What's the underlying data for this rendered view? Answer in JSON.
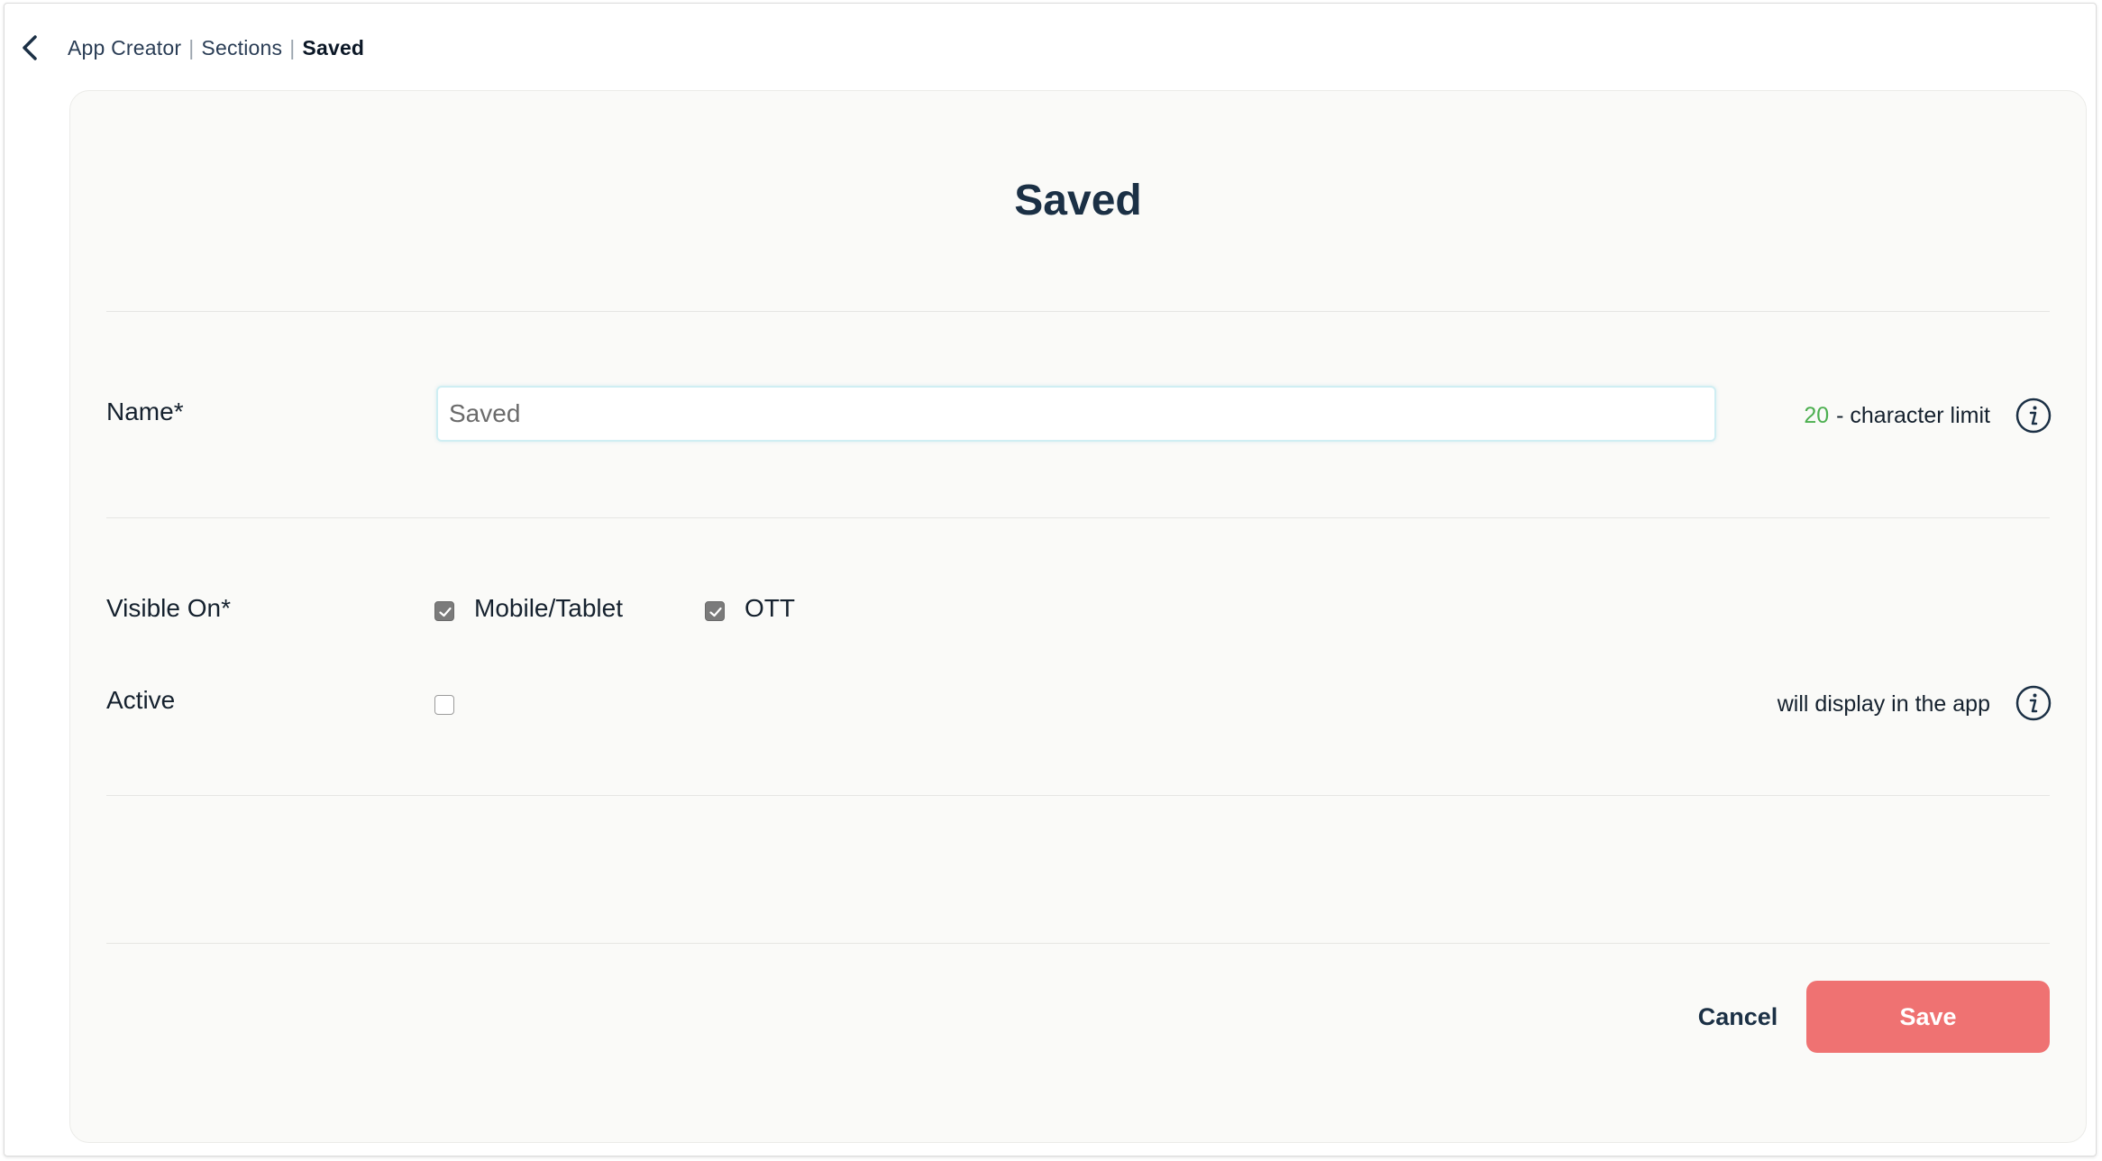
{
  "breadcrumb": {
    "items": [
      "App Creator",
      "Sections"
    ],
    "separator": "|",
    "current": "Saved"
  },
  "page": {
    "title": "Saved"
  },
  "form": {
    "name": {
      "label": "Name*",
      "value": "Saved",
      "char_limit_count": "20",
      "char_limit_text": "- character limit"
    },
    "visible_on": {
      "label": "Visible On*",
      "options": [
        {
          "label": "Mobile/Tablet",
          "checked": true
        },
        {
          "label": "OTT",
          "checked": true
        }
      ]
    },
    "active": {
      "label": "Active",
      "checked": false,
      "hint": "will display in the app"
    }
  },
  "actions": {
    "cancel_label": "Cancel",
    "save_label": "Save"
  },
  "colors": {
    "accent_save": "#ef7272",
    "count_green": "#4caf50",
    "text_dark": "#1b3045"
  },
  "icons": {
    "back": "chevron-left-icon",
    "info": "info-circle-icon",
    "check": "checkmark-icon"
  }
}
